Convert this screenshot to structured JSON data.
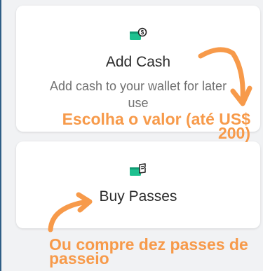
{
  "cards": {
    "add_cash": {
      "icon": "wallet-cash-icon",
      "title": "Add Cash",
      "description": "Add cash to your wallet for later use"
    },
    "buy_passes": {
      "icon": "ticket-pass-icon",
      "title": "Buy Passes"
    }
  },
  "annotations": {
    "choose_value": "Escolha o valor (até US$ 200)",
    "buy_passes": "Ou compre dez passes de passeio"
  },
  "colors": {
    "accent_green": "#1ec08f",
    "annotation_orange": "#f79a4a",
    "background": "#f1f2f4",
    "left_edge": "#2f5e86"
  }
}
